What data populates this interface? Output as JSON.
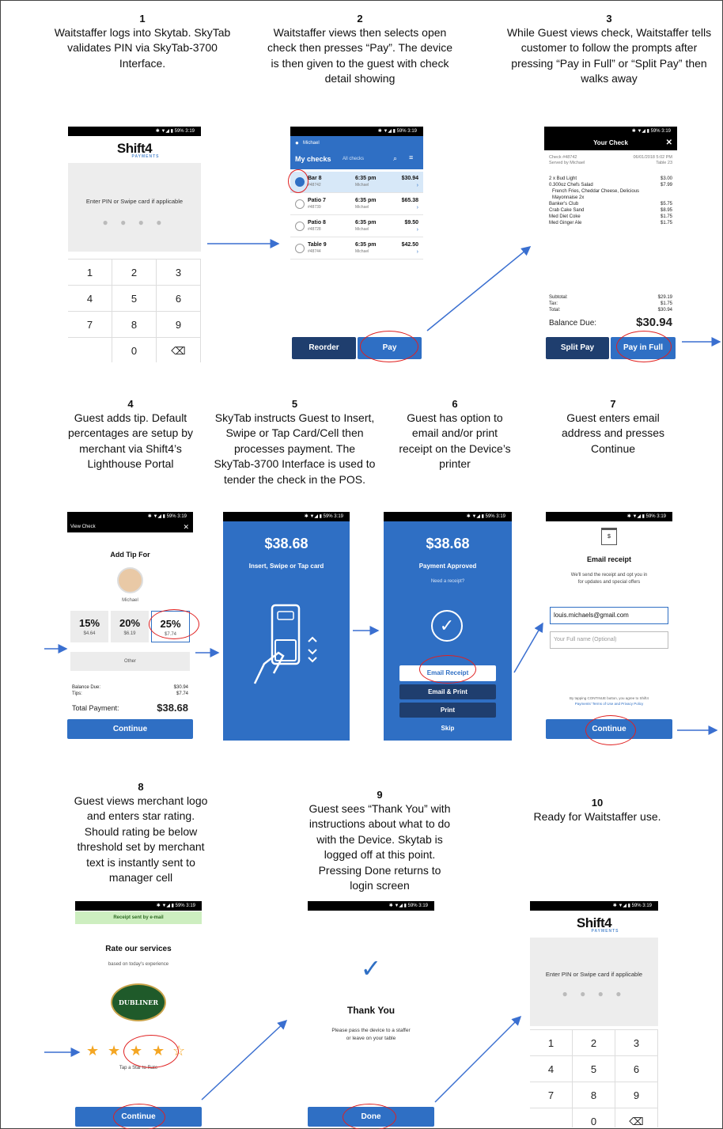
{
  "steps": [
    {
      "num": "1",
      "lines": [
        "Waitstaffer logs into Skytab. SkyTab",
        "validates PIN via SkyTab-3700",
        "Interface."
      ]
    },
    {
      "num": "2",
      "lines": [
        "Waitstaffer views then selects open",
        "check then presses “Pay”.  The device",
        "is then given to the guest with check",
        "detail showing"
      ]
    },
    {
      "num": "3",
      "lines": [
        "While Guest views check, Waitstaffer tells",
        "customer to follow the prompts after",
        "pressing “Pay in Full”  or “Split Pay” then",
        "walks away"
      ]
    },
    {
      "num": "4",
      "lines": [
        "Guest adds tip. Default",
        "percentages are setup by",
        "merchant via Shift4’s",
        "Lighthouse Portal"
      ]
    },
    {
      "num": "5",
      "lines": [
        "SkyTab instructs Guest to Insert,",
        "Swipe or Tap Card/Cell then",
        "processes payment.  The",
        "SkyTab-3700 Interface is used to",
        "tender the check in the POS."
      ]
    },
    {
      "num": "6",
      "lines": [
        "Guest has option to",
        "email and/or print",
        "receipt on the Device’s",
        "printer"
      ]
    },
    {
      "num": "7",
      "lines": [
        "Guest enters email",
        "address and presses",
        "Continue"
      ]
    },
    {
      "num": "8",
      "lines": [
        "Guest views merchant logo",
        "and enters star rating.",
        "Should rating be below",
        "threshold set by merchant",
        "text is instantly sent to",
        "manager cell"
      ]
    },
    {
      "num": "9",
      "lines": [
        "Guest sees “Thank You” with",
        "instructions about what to do",
        "with the Device.  Skytab is",
        "logged off at this point.",
        "Pressing Done returns to",
        "login screen"
      ]
    },
    {
      "num": "10",
      "lines": [
        "Ready for Waitstaffer use."
      ]
    }
  ],
  "status_bar": "✱ ▼◢ ▮ 59%  3:19",
  "login": {
    "brand": "Shift4",
    "brand_sub": "PAYMENTS",
    "prompt": "Enter PIN or Swipe card if applicable",
    "dots": "● ● ● ●",
    "keys": [
      "1",
      "2",
      "3",
      "4",
      "5",
      "6",
      "7",
      "8",
      "9",
      "",
      "0",
      "⌫"
    ]
  },
  "checks": {
    "user": "Michael",
    "title": "My checks",
    "filter": "All checks",
    "rows": [
      {
        "name": "Bar 8",
        "id": "#48742",
        "time": "6:35 pm",
        "waiter": "Michael",
        "amount": "$30.94",
        "selected": true
      },
      {
        "name": "Patio 7",
        "id": "#48739",
        "time": "6:35 pm",
        "waiter": "Michael",
        "amount": "$65.38",
        "selected": false
      },
      {
        "name": "Patio 8",
        "id": "#48728",
        "time": "6:35 pm",
        "waiter": "Michael",
        "amount": "$9.50",
        "selected": false
      },
      {
        "name": "Table 9",
        "id": "#48744",
        "time": "6:35 pm",
        "waiter": "Michael",
        "amount": "$42.50",
        "selected": false
      }
    ],
    "reorder": "Reorder",
    "pay": "Pay"
  },
  "your_check": {
    "title": "Your Check",
    "check_no": "Check #48742",
    "date": "06/01/2018 5:02 PM",
    "served": "Served by Michael",
    "table": "Table 23",
    "items": [
      {
        "n": "2 x Bud Light",
        "p": "$3.00"
      },
      {
        "n": "0.300oz Chefs Salad",
        "p": "$7.99"
      },
      {
        "n": "   French Fries, Cheddar Cheese, Delicious",
        "p": ""
      },
      {
        "n": "   Mayonnaise 2x",
        "p": ""
      },
      {
        "n": "Banker's Club",
        "p": "$5.75"
      },
      {
        "n": "Crab Cake Sand",
        "p": "$8.95"
      },
      {
        "n": "Med Diet Coke",
        "p": "$1.75"
      },
      {
        "n": "Med Ginger Ale",
        "p": "$1.75"
      }
    ],
    "subtotal_l": "Subtotal:",
    "subtotal": "$29.19",
    "tax_l": "Tax:",
    "tax": "$1.75",
    "total_l": "Total:",
    "total": "$30.94",
    "due_l": "Balance Due:",
    "due": "$30.94",
    "split": "Split Pay",
    "full": "Pay in Full"
  },
  "tip": {
    "header": "View Check",
    "title": "Add Tip For",
    "server": "Michael",
    "options": [
      {
        "pct": "15%",
        "amt": "$4.64"
      },
      {
        "pct": "20%",
        "amt": "$6.19"
      },
      {
        "pct": "25%",
        "amt": "$7.74"
      }
    ],
    "other": "Other",
    "due_l": "Balance Due:",
    "due": "$30.94",
    "tips_l": "Tips:",
    "tips": "$7.74",
    "total_l": "Total Payment:",
    "total": "$38.68",
    "continue": "Continue"
  },
  "card": {
    "amount": "$38.68",
    "prompt": "Insert, Swipe or Tap card"
  },
  "approved": {
    "amount": "$38.68",
    "status": "Payment Approved",
    "question": "Need a receipt?",
    "email": "Email Receipt",
    "email_print": "Email & Print",
    "print": "Print",
    "skip": "Skip"
  },
  "email": {
    "title": "Email receipt",
    "desc1": "We'll send the receipt and opt you in",
    "desc2": "for updates and special offers",
    "value": "louis.michaels@gmail.com",
    "name_ph": "Your Full name (Optional)",
    "terms1": "By tapping CONTINUE button, you agree to Shift4",
    "terms2": "Payments' Terms of Use and Privacy Policy",
    "continue": "Continue"
  },
  "rate": {
    "banner": "Receipt sent by e-mail",
    "title": "Rate our services",
    "subtitle": "based on today's experience",
    "logo": "DUBLINER",
    "tap": "Tap a Star to Rate",
    "rating": 4,
    "continue": "Continue"
  },
  "thanks": {
    "title": "Thank You",
    "line1": "Please pass the device to a staffer",
    "line2": "or leave on your table",
    "done": "Done"
  },
  "colors": {
    "brand_blue": "#2f6fc4",
    "navy": "#1f3e6e",
    "annotation_red": "#e02020",
    "star": "#f4a623"
  }
}
